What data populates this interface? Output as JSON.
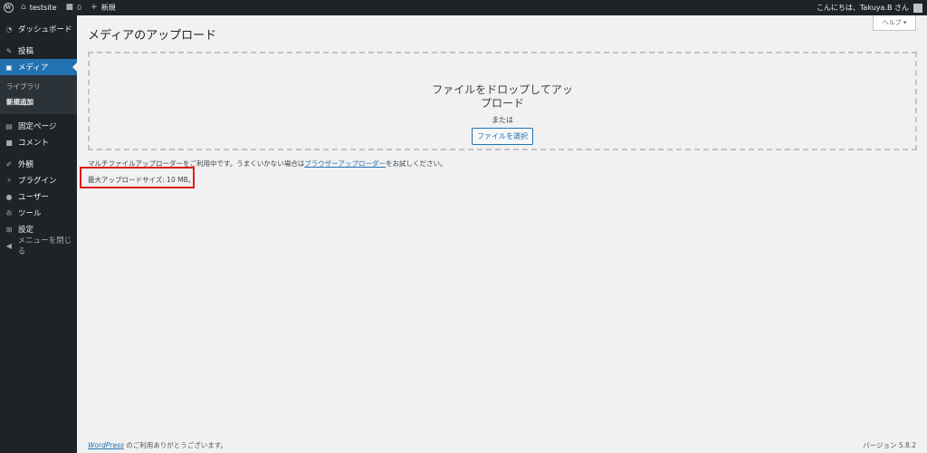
{
  "adminbar": {
    "site_name": "testsite",
    "comments_count": "0",
    "new_label": "新規",
    "greeting": "こんにちは、Takuya.B さん"
  },
  "sidebar": {
    "dashboard": "ダッシュボード",
    "posts": "投稿",
    "media": "メディア",
    "media_sub": [
      "ライブラリ",
      "新規追加"
    ],
    "pages": "固定ページ",
    "comments": "コメント",
    "appearance": "外観",
    "plugins": "プラグイン",
    "users": "ユーザー",
    "tools": "ツール",
    "settings": "設定",
    "collapse": "メニューを閉じる"
  },
  "header": {
    "help_label": "ヘルプ ▾",
    "title": "メディアのアップロード"
  },
  "dropzone": {
    "title": "ファイルをドロップしてアップロード",
    "or_label": "または",
    "select_button": "ファイルを選択"
  },
  "info": {
    "uploader_text_pre": "マルチファイルアップローダーをご利用中です。うまくいかない場合は",
    "uploader_link": "ブラウザーアップローダー",
    "uploader_text_post": "をお試しください。",
    "max_size": "最大アップロードサイズ: 10 MB。"
  },
  "footer": {
    "link": "WordPress",
    "thanks": " のご利用ありがとうございます。",
    "version": "バージョン 5.8.2"
  },
  "colors": {
    "accent": "#2271b1",
    "adminbar_bg": "#1d2327",
    "highlight_box": "#e21c1c"
  }
}
